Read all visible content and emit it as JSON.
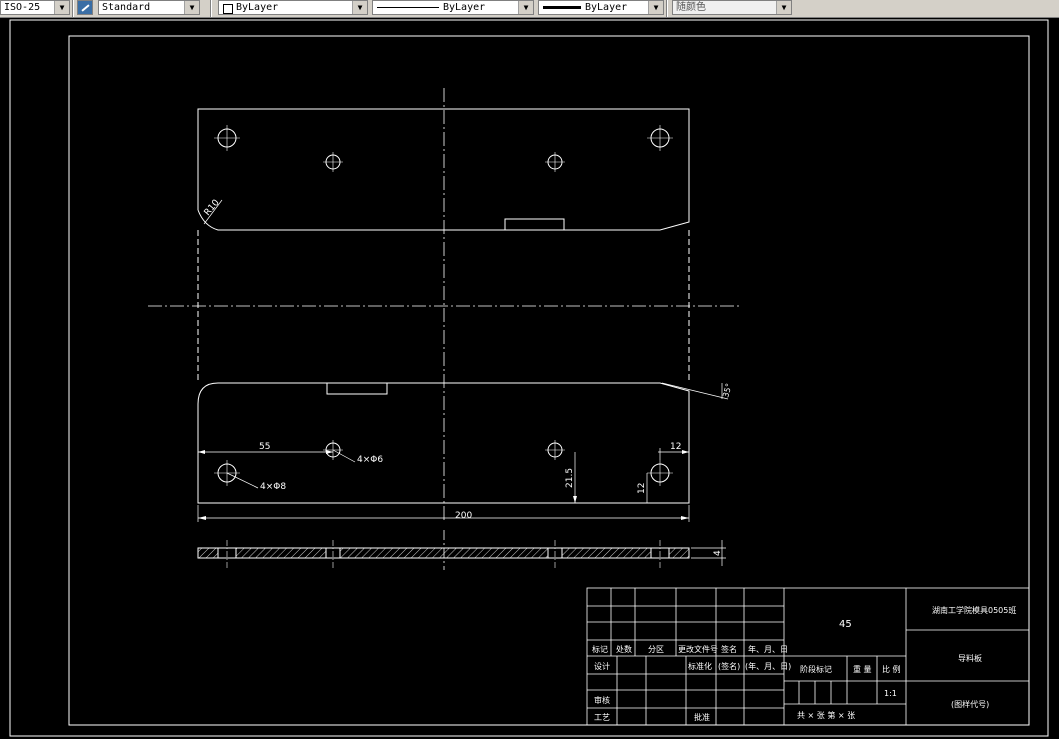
{
  "toolbar": {
    "dimstyle": "ISO-25",
    "textstyle": "Standard",
    "color": "ByLayer",
    "linetype": "ByLayer",
    "lineweight": "ByLayer",
    "plotstyle": "随颜色"
  },
  "drawing": {
    "fillet_label": "R10",
    "angle_label": "35°",
    "dim_55": "55",
    "hole_note_small": "4×Φ6",
    "hole_note_large": "4×Φ8",
    "dim_12_top": "12",
    "dim_215": "21.5",
    "dim_12_side": "12",
    "dim_200": "200",
    "dim_4": "4"
  },
  "title_block": {
    "material": "45",
    "company": "湖南工学院模具0505班",
    "part_name": "导料板",
    "drawing_no": "(图样代号)",
    "rev_headers": [
      "标记",
      "处数",
      "分区",
      "更改文件号",
      "签名",
      "年、月、日"
    ],
    "row_design": "设计",
    "row_standard": "标准化",
    "row_sign": "(签名)",
    "row_date": "(年、月、日)",
    "stage_label": "阶段标记",
    "weight_label": "重 量",
    "scale_label": "比 例",
    "scale_value": "1:1",
    "check_label": "审核",
    "process_label": "工艺",
    "approve_label": "批准",
    "sheets_label": "共  ×  张  第  ×  张"
  }
}
